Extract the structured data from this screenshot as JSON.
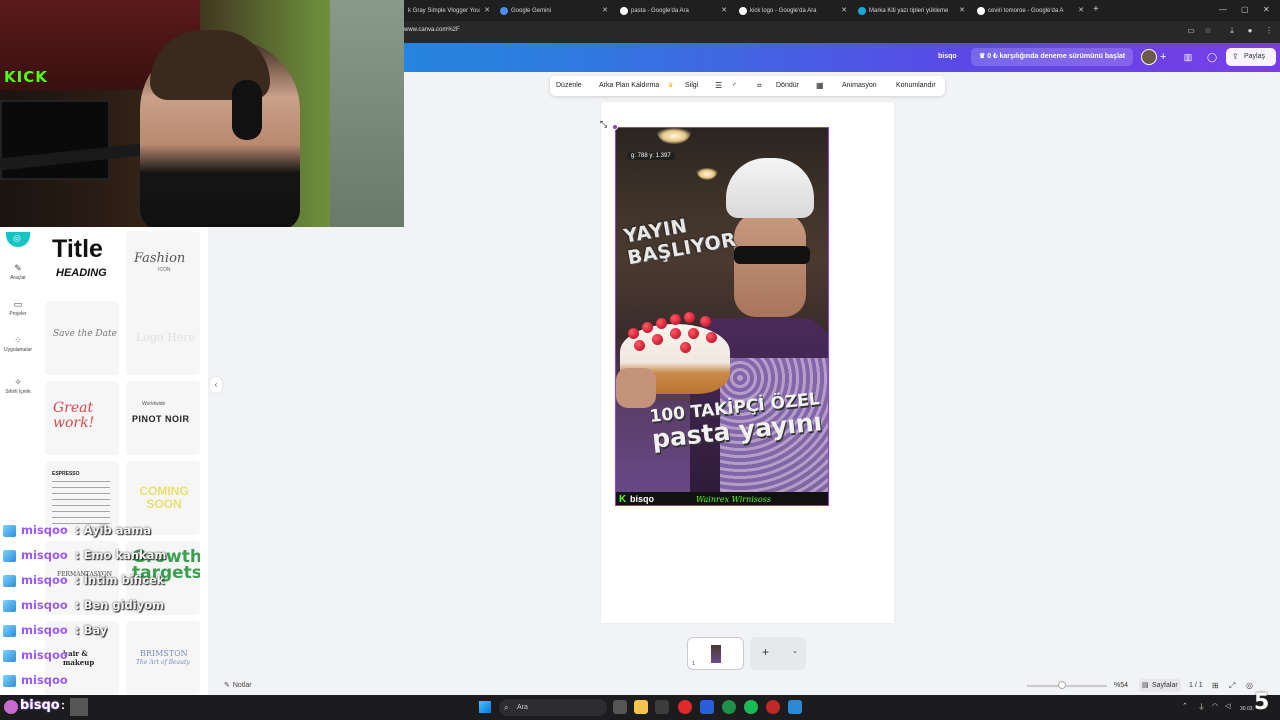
{
  "browser": {
    "tabs": [
      {
        "label": "k Gray Simple Vlogger You",
        "icon": "youtube-icon"
      },
      {
        "label": "Google Gemini",
        "icon": "gemini-icon"
      },
      {
        "label": "pasta - Google'da Ara",
        "icon": "google-icon"
      },
      {
        "label": "kick logo - Google'da Ara",
        "icon": "google-icon"
      },
      {
        "label": "Marka Kiti yazı tipleri yükleme",
        "icon": "canva-icon"
      },
      {
        "label": "ceviri tomoroe - Google'da A",
        "icon": "google-icon"
      }
    ],
    "new_tab": "+",
    "url": "www.canva.com%2F"
  },
  "canva_header": {
    "user_name": "bisqo",
    "trial_text": "0 ₺ karşılığında deneme sürümünü başlat",
    "trial_icon": "crown-icon",
    "share_label": "Paylaş"
  },
  "toolbar": {
    "edit": "Düzenle",
    "bg_remove": "Arka Plan Kaldırma",
    "eraser": "Silgi",
    "rotate": "Döndür",
    "animate": "Animasyon",
    "position": "Konumlandır"
  },
  "canvas": {
    "coord_readout": "g: 788 y: 1.397",
    "design": {
      "headline_top": "YAYIN BAŞLIYOR",
      "headline_line1": "100 TAKİPÇİ ÖZEL",
      "headline_line2": "pasta yayını",
      "brand": "bisqo",
      "brand_mark": "K",
      "signature": "Wainrex Wirnisoss"
    },
    "page_number": "1"
  },
  "sidebar": {
    "items": [
      {
        "label": "Araçlar",
        "icon": "tools-icon"
      },
      {
        "label": "Projeler",
        "icon": "folder-icon"
      },
      {
        "label": "Uygulamalar",
        "icon": "apps-icon"
      },
      {
        "label": "Sihirli İçerik",
        "icon": "magic-icon"
      }
    ],
    "templates": [
      {
        "title": "Title",
        "subtitle": "HEADING"
      },
      {
        "title": "Fashion",
        "subtitle": "ICON"
      },
      {
        "title": "Save the Date",
        "subtitle": ""
      },
      {
        "title": "Logo Here",
        "subtitle": ""
      },
      {
        "title": "Great work!",
        "subtitle": ""
      },
      {
        "title": "PINOT NOIR",
        "subtitle": "Worldwide"
      },
      {
        "title": "ESPRESSO",
        "subtitle": ""
      },
      {
        "title": "COMING SOON",
        "subtitle": ""
      },
      {
        "title": "FERMANTASYON",
        "subtitle": ""
      },
      {
        "title": "Growth targets",
        "subtitle": ""
      },
      {
        "title": "hair & makeup",
        "subtitle": ""
      },
      {
        "title": "BRIMSTON",
        "subtitle": "The Art of Beauty"
      }
    ],
    "collapse": "‹"
  },
  "notes_label": "Notlar",
  "status_bar": {
    "zoom": "%54",
    "zoom_level": 0.54,
    "pages_label": "Sayfalar",
    "page_count": "1 / 1"
  },
  "chat": [
    {
      "user": "misqoo",
      "message": ": Ayib aama"
    },
    {
      "user": "misqoo",
      "message": ": Emo kankam"
    },
    {
      "user": "misqoo",
      "message": ": İntim bificek"
    },
    {
      "user": "misqoo",
      "message": ": Ben gidiyom"
    },
    {
      "user": "misqoo",
      "message": ": Bay"
    },
    {
      "user": "misqoo",
      "message": ""
    },
    {
      "user": "misqoo",
      "message": ""
    }
  ],
  "taskbar": {
    "streamer": "bisqo",
    "colon": ":",
    "search_placeholder": "Ara",
    "clock": "30.03.",
    "corner_badge": "5"
  },
  "colors": {
    "canva_purple": "#8b3dff",
    "kick_green": "#53fc18",
    "chat_name": "#9b59ff"
  }
}
